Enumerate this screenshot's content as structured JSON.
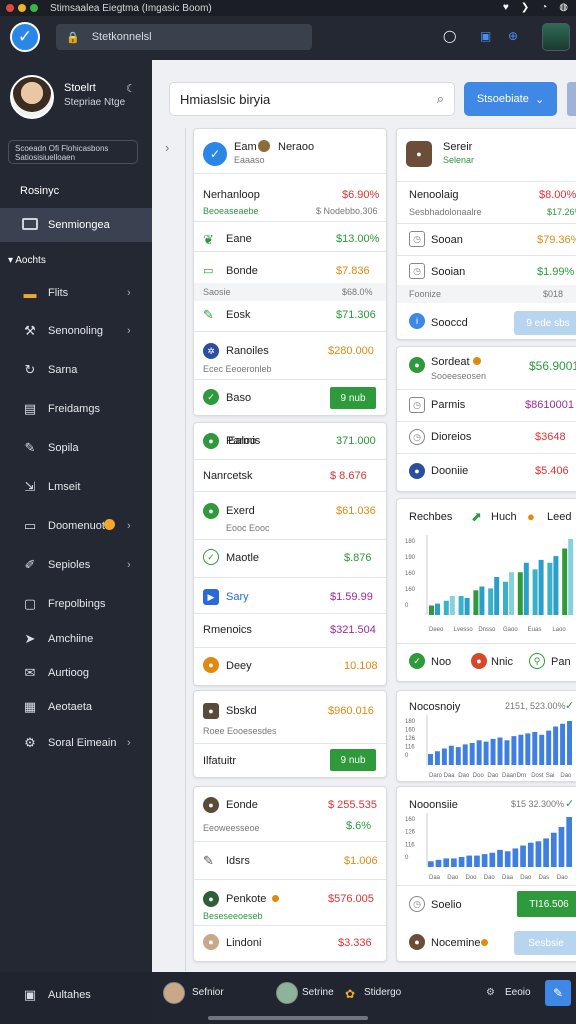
{
  "status_bar": {
    "title": "Stimsaalea Eiegtma (Imgasic Boom)",
    "dot_colors": [
      "#e5483b",
      "#f0b429",
      "#3bb54a"
    ],
    "icons": [
      "heart-icon",
      "chevron-icon",
      "wifi-icon",
      "signal-icon"
    ]
  },
  "header": {
    "search_value": "Stetkonnelsl",
    "icons": [
      "circle-icon",
      "camera-icon",
      "globe-icon"
    ]
  },
  "sidebar": {
    "profile_name": "Stoelrt",
    "profile_role": "Stepriae Ntge",
    "profile_badge_line1": "Scoeadn Ofi Flohicasbons",
    "profile_badge_line2": "Satiosisiuelloaen",
    "nav_head": "Rosinyc",
    "active_item": "Senmiongea",
    "section": "Aochts",
    "items": [
      {
        "label": "Flits",
        "icon": "folder-icon",
        "chevron": true
      },
      {
        "label": "Senonoling",
        "icon": "tools-icon",
        "chevron": true
      },
      {
        "label": "Sarna",
        "icon": "refresh-icon",
        "chevron": false
      },
      {
        "label": "Freidamgs",
        "icon": "document-icon",
        "chevron": false
      },
      {
        "label": "Sopila",
        "icon": "brush-icon",
        "chevron": false
      },
      {
        "label": "Lmseit",
        "icon": "export-icon",
        "chevron": false
      },
      {
        "label": "Doomenuot",
        "icon": "briefcase-icon",
        "chevron": true
      },
      {
        "label": "Sepioles",
        "icon": "pen-icon",
        "chevron": true
      },
      {
        "label": "Frepolbings",
        "icon": "report-icon",
        "chevron": false
      },
      {
        "label": "Amchiine",
        "icon": "send-icon",
        "chevron": false
      },
      {
        "label": "Aurtioog",
        "icon": "mail-icon",
        "chevron": false
      },
      {
        "label": "Aeotaeta",
        "icon": "calendar-icon",
        "chevron": false
      },
      {
        "label": "Soral Eimeain",
        "icon": "gear-icon",
        "chevron": true
      }
    ],
    "footer_label": "Aultahes"
  },
  "content": {
    "search_value": "Hmiaslsic biryia",
    "primary_button": "Stsoebiate",
    "col1": {
      "card1": {
        "head_title": "Eam",
        "head_title2": "Neraoo",
        "head_sub": "Eaaaso",
        "rows": [
          {
            "label": "Nerhanloop",
            "sub": "Beoeaseaebe",
            "value": "$6.90%",
            "value2": "$ Nodebbo.306"
          },
          {
            "label": "Eane",
            "value": "$13.00%"
          },
          {
            "label": "Bonde",
            "value": "$7.836"
          },
          {
            "label": "Saosie",
            "value": "$68.0%"
          },
          {
            "label": "Eosk",
            "value": "$71.306"
          },
          {
            "label": "Ranoiles",
            "sub": "Ecec Eeoeronleb",
            "value": "$280.000"
          },
          {
            "label": "Baso",
            "button": "9 nub"
          }
        ]
      },
      "card2": {
        "rows": [
          {
            "label": "Ealoo",
            "value": "371.000"
          },
          {
            "label": "Nanrcetsk",
            "value": "$ 8.676"
          },
          {
            "label": "Exerd",
            "sub": "Eooc Eooc",
            "value": "$61.036"
          },
          {
            "label": "Maotle",
            "value": "$.876"
          },
          {
            "label": "Sary",
            "value": "$1.59.99"
          },
          {
            "label": "Rmenoics",
            "value": "$321.504"
          },
          {
            "label": "Deey",
            "value": "10.108"
          }
        ]
      },
      "card3": {
        "rows": [
          {
            "label": "Sbskd",
            "sub": "Roee Eooesesdes",
            "value": "$960.016"
          },
          {
            "label": "Ilfatuitr",
            "button": "9 nub"
          }
        ]
      },
      "card4": {
        "rows": [
          {
            "label": "Eonde",
            "sub": "Eeoweesseoe",
            "value": "$ 255.535",
            "value2": "$.6%"
          },
          {
            "label": "Idsrs",
            "value": "$1.006"
          },
          {
            "label": "Penkote",
            "sub": "Beseseeoeseb",
            "value": "$576.005"
          },
          {
            "label": "Lindoni",
            "value": "$3.336"
          }
        ]
      }
    },
    "col2": {
      "card1": {
        "head_title": "Sereir",
        "head_sub": "Selenar",
        "rows": [
          {
            "label": "Nenoolaig",
            "sub": "Sesbhadolonaalre",
            "value": "$8.00%",
            "value2": "$17.26%"
          },
          {
            "label": "Sooan",
            "value": "$79.36%"
          },
          {
            "label": "Sooian",
            "value": "$1.99%"
          },
          {
            "label": "Foonize",
            "value": "$018"
          },
          {
            "label": "Sooccd",
            "button": "9 ede sbs"
          }
        ]
      },
      "card2": {
        "head_title": "Sordeat",
        "head_sub": "Sooeeseosen",
        "head_value": "$56.9001",
        "rows": [
          {
            "label": "Parmis",
            "value": "$8610001"
          },
          {
            "label": "Dioreios",
            "value": "$3648"
          },
          {
            "label": "Dooniie",
            "value": "$5.406"
          }
        ]
      },
      "chart1": {
        "title": "Rechbes",
        "legend": [
          "Huch",
          "Leed"
        ],
        "footer": [
          "Noo",
          "Nnic",
          "Pan"
        ]
      },
      "chart2": {
        "title": "Nocosnoiy",
        "value": "2151, 523.00%"
      },
      "chart3": {
        "title": "Nooonsiie",
        "value": "$15 32.300%",
        "rows": [
          {
            "label": "Soelio",
            "button": "TI16.506"
          },
          {
            "label": "Nocemine",
            "button": "Sesbsie"
          }
        ]
      }
    }
  },
  "bottom": {
    "items": [
      "Sefnior",
      "Setrine",
      "Stidergo",
      "Eeoio"
    ]
  },
  "chart_data": [
    {
      "type": "bar",
      "title": "Rechbes",
      "y_tick_labels": [
        "180",
        "190",
        "160",
        "160",
        "0"
      ],
      "x_tick_labels": [
        "Deeo",
        "Lvesso",
        "Dnsso",
        "Gaoo",
        "Euas",
        "Laoo"
      ],
      "series": [
        {
          "name": "Huch",
          "values": [
            10,
            15,
            20,
            26,
            28,
            35,
            45,
            48,
            55,
            70
          ]
        },
        {
          "name": "Leed",
          "values": [
            12,
            20,
            18,
            30,
            40,
            45,
            55,
            58,
            62,
            80
          ]
        }
      ]
    },
    {
      "type": "bar",
      "title": "Nocosnoiy",
      "y_tick_labels": [
        "180",
        "160",
        "126",
        "116",
        "0"
      ],
      "x_tick_labels": [
        "Daro",
        "Daa",
        "Dao",
        "Doo",
        "Dao",
        "Daan",
        "Drn",
        "Dost",
        "Sai",
        "Dao"
      ],
      "values": [
        8,
        10,
        12,
        14,
        13,
        15,
        16,
        18,
        17,
        19,
        20,
        18,
        21,
        22,
        23,
        24,
        22,
        25,
        28,
        30,
        32
      ]
    },
    {
      "type": "bar",
      "title": "Nooonsiie",
      "y_tick_labels": [
        "160",
        "126",
        "116",
        "0"
      ],
      "x_tick_labels": [
        "Daa",
        "Dao",
        "Doo",
        "Dao",
        "Daa",
        "Dao",
        "Das",
        "Dao"
      ],
      "values": [
        4,
        5,
        6,
        6,
        7,
        8,
        8,
        9,
        10,
        12,
        11,
        13,
        15,
        17,
        18,
        20,
        24,
        28,
        35
      ]
    }
  ]
}
